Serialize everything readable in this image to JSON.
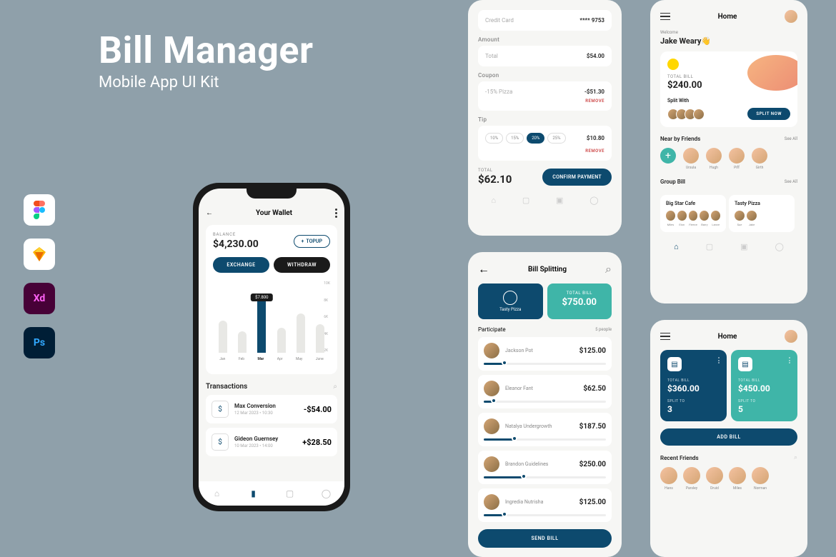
{
  "hero": {
    "title": "Bill Manager",
    "subtitle": "Mobile App UI Kit"
  },
  "tools": [
    "figma",
    "sketch",
    "xd",
    "photoshop"
  ],
  "wallet": {
    "title": "Your Wallet",
    "balance_label": "BALANCE",
    "balance": "$4,230.00",
    "topup": "TOPUP",
    "exchange": "EXCHANGE",
    "withdraw": "WITHDRAW",
    "tooltip": "$7.800",
    "y_axis": [
      "10K",
      "8K",
      "6K",
      "4K",
      "2K"
    ],
    "x_axis": [
      "Jan",
      "Feb",
      "Mar",
      "Apr",
      "May",
      "June"
    ],
    "trans_title": "Transactions",
    "trans": [
      {
        "name": "Max Conversion",
        "date": "12 Mar 2023 • 10:30",
        "amount": "-$54.00"
      },
      {
        "name": "Gideon Guernsey",
        "date": "10 Mar 2023 • 14:00",
        "amount": "+$28.50"
      }
    ]
  },
  "chart_data": {
    "type": "bar",
    "categories": [
      "Jan",
      "Feb",
      "Mar",
      "Apr",
      "May",
      "June"
    ],
    "values": [
      4.5,
      3.0,
      7.8,
      3.5,
      5.5,
      4.0
    ],
    "ylabel": "",
    "ylim": [
      0,
      10
    ],
    "title": "",
    "highlighted": "Mar",
    "highlighted_value": 7.8
  },
  "checkout": {
    "cc_label": "Credit Card",
    "cc_value": "**** 9753",
    "amount_label": "Amount",
    "total_label": "Total",
    "total_value": "$54.00",
    "coupon_label": "Coupon",
    "coupon_name": "-15% Pizza",
    "coupon_value": "-$51.30",
    "remove": "REMOVE",
    "tip_label": "Tip",
    "tips": [
      "10%",
      "15%",
      "20%",
      "25%"
    ],
    "tip_value": "$10.80",
    "grand_label": "TOTAL",
    "grand_total": "$62.10",
    "confirm": "CONFIRM PAYMENT"
  },
  "split": {
    "title": "Bill Splitting",
    "vendor": "Tasty Pizza",
    "total_label": "TOTAL BILL",
    "total": "$750.00",
    "participate": "Participate",
    "count": "5 people",
    "people": [
      {
        "name": "Jackson Pot",
        "amount": "$125.00",
        "pct": 17
      },
      {
        "name": "Eleanor Fant",
        "amount": "$62.50",
        "pct": 8
      },
      {
        "name": "Natalya Undergrowth",
        "amount": "$187.50",
        "pct": 25
      },
      {
        "name": "Brandon Guidelines",
        "amount": "$250.00",
        "pct": 33
      },
      {
        "name": "Ingredia Nutrisha",
        "amount": "$125.00",
        "pct": 17
      }
    ],
    "send": "SEND BILL"
  },
  "home1": {
    "title": "Home",
    "welcome": "Welcome",
    "name": "Jake Weary👋",
    "bill_label": "TOTAL BILL",
    "bill_amount": "$240.00",
    "split_with": "Split With",
    "split_now": "SPLIT NOW",
    "nearby": "Near by Friends",
    "see_all": "See All",
    "friends": [
      "Ursula",
      "Hugh",
      "Piff",
      "Girth"
    ],
    "group_bill": "Group Bill",
    "groups": [
      {
        "name": "Big Star Cafe",
        "members": [
          "Miles",
          "Elon",
          "Fleece",
          "Barry",
          "Lance"
        ]
      },
      {
        "name": "Tasty Pizza",
        "members": [
          "Sue",
          "Jake"
        ]
      }
    ]
  },
  "home2": {
    "title": "Home",
    "cards": [
      {
        "label": "TOTAL BILL",
        "amount": "$360.00",
        "split_label": "SPLIT TO",
        "split": "3"
      },
      {
        "label": "TOTAL BILL",
        "amount": "$450.00",
        "split_label": "SPLIT TO",
        "split": "5"
      }
    ],
    "add_bill": "ADD BILL",
    "recent": "Recent Friends",
    "friends": [
      "Hans",
      "Parsley",
      "Druid",
      "Miles",
      "Norman"
    ]
  }
}
